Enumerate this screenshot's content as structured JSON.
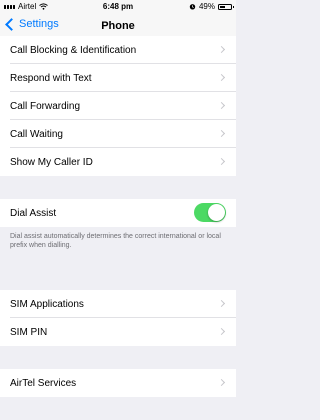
{
  "status_bar": {
    "carrier": "Airtel",
    "time": "6:48 pm",
    "battery": "49%",
    "battery_level": 0.49,
    "icons": [
      "signal-icon",
      "wifi-icon",
      "alarm-icon",
      "battery-icon"
    ]
  },
  "nav": {
    "back_label": "Settings",
    "title": "Phone"
  },
  "group1": {
    "items": [
      {
        "label": "Call Blocking & Identification"
      },
      {
        "label": "Respond with Text"
      },
      {
        "label": "Call Forwarding"
      },
      {
        "label": "Call Waiting"
      },
      {
        "label": "Show My Caller ID"
      }
    ]
  },
  "dial_assist": {
    "label": "Dial Assist",
    "enabled": true,
    "footer": "Dial assist automatically determines the correct international or local prefix when dialling."
  },
  "group2": {
    "items": [
      {
        "label": "SIM Applications"
      },
      {
        "label": "SIM PIN"
      }
    ]
  },
  "group3": {
    "items": [
      {
        "label": "AirTel Services"
      }
    ]
  },
  "colors": {
    "accent": "#007aff",
    "toggle_on": "#4cd964",
    "background": "#efeff4"
  }
}
